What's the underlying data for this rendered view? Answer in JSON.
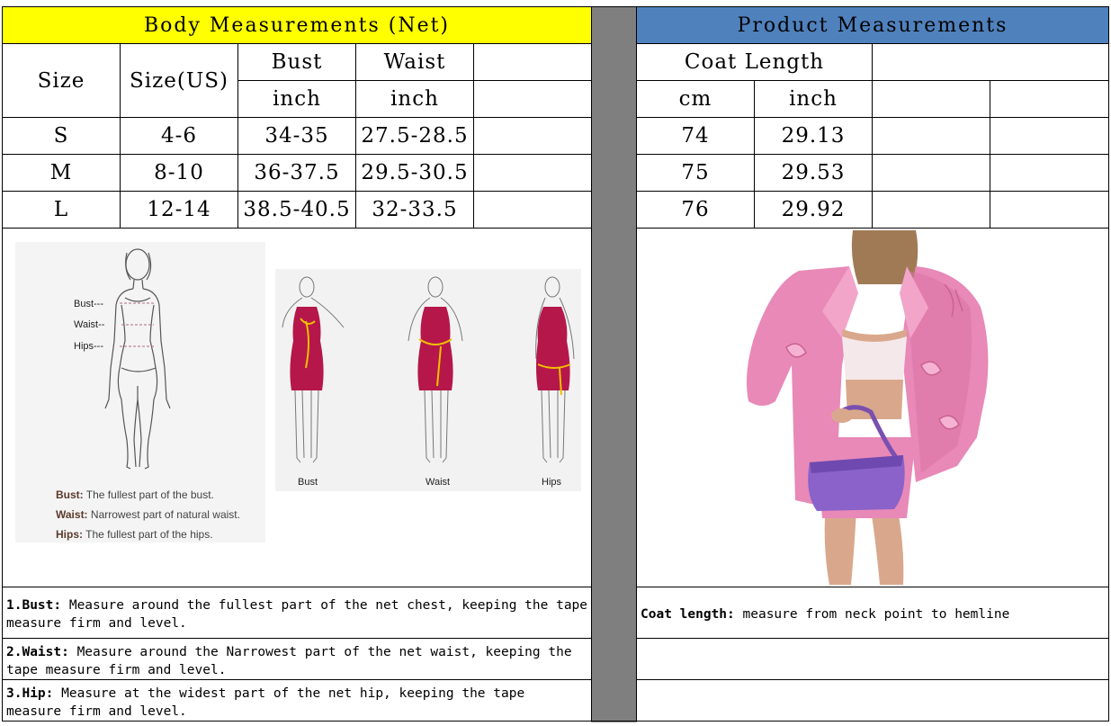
{
  "body_table": {
    "title": "Body Measurements (Net)",
    "col_size": "Size",
    "col_size_us": "Size(US)",
    "col_bust": "Bust",
    "col_waist": "Waist",
    "unit_bust": "inch",
    "unit_waist": "inch",
    "rows": [
      {
        "size": "S",
        "us": "4-6",
        "bust": "34-35",
        "waist": "27.5-28.5"
      },
      {
        "size": "M",
        "us": "8-10",
        "bust": "36-37.5",
        "waist": "29.5-30.5"
      },
      {
        "size": "L",
        "us": "12-14",
        "bust": "38.5-40.5",
        "waist": "32-33.5"
      }
    ],
    "header_color": "#ffff00"
  },
  "product_table": {
    "title": "Product Measurements",
    "col_coat": "Coat Length",
    "unit_cm": "cm",
    "unit_inch": "inch",
    "rows": [
      {
        "cm": "74",
        "inch": "29.13"
      },
      {
        "cm": "75",
        "inch": "29.53"
      },
      {
        "cm": "76",
        "inch": "29.92"
      }
    ],
    "header_color": "#4f81bd"
  },
  "figure_left": {
    "labels": {
      "bust": "Bust---",
      "waist": "Waist--",
      "hips": "Hips---"
    },
    "legend": [
      {
        "term": "Bust:",
        "text": "The fullest part of the bust."
      },
      {
        "term": "Waist:",
        "text": "Narrowest part of natural waist."
      },
      {
        "term": "Hips:",
        "text": "The fullest part of the hips."
      }
    ]
  },
  "figure_right": {
    "captions": [
      "Bust",
      "Waist",
      "Hips"
    ],
    "dress_color": "#b5174b",
    "tape_color": "#f0c000"
  },
  "notes": {
    "bust_term": "1.Bust:",
    "bust_text": "Measure around the fullest part of the net chest, keeping the tape  measure firm and level.",
    "waist_term": "2.Waist:",
    "waist_text": "Measure around the Narrowest part of the net waist, keeping the tape  measure firm and level.",
    "hip_term": "3.Hip:",
    "hip_text": "Measure at the widest part of the net hip, keeping the tape measure firm and level.",
    "coat_term": "Coat length:",
    "coat_text": "measure from neck point to hemline"
  },
  "photo": {
    "icon": "pink-blazer-photo",
    "jacket_color": "#e889b8",
    "bag_color": "#8a62c9"
  }
}
